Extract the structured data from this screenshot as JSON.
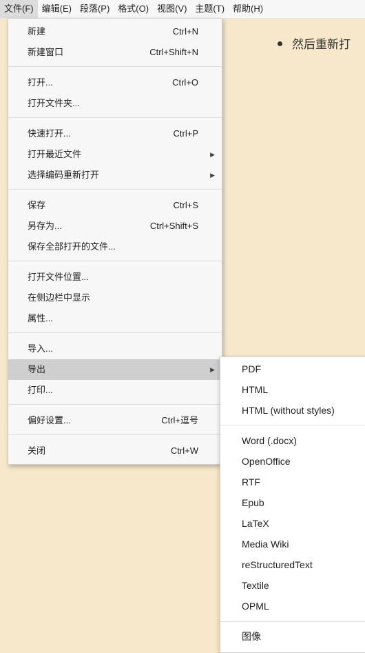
{
  "menubar": {
    "items": [
      "文件(F)",
      "编辑(E)",
      "段落(P)",
      "格式(O)",
      "视图(V)",
      "主题(T)",
      "帮助(H)"
    ]
  },
  "document": {
    "bullet_text": "然后重新打"
  },
  "file_menu": {
    "new": {
      "label": "新建",
      "shortcut": "Ctrl+N"
    },
    "new_window": {
      "label": "新建窗口",
      "shortcut": "Ctrl+Shift+N"
    },
    "open": {
      "label": "打开...",
      "shortcut": "Ctrl+O"
    },
    "open_folder": {
      "label": "打开文件夹..."
    },
    "quick_open": {
      "label": "快速打开...",
      "shortcut": "Ctrl+P"
    },
    "open_recent": {
      "label": "打开最近文件"
    },
    "reopen_encoding": {
      "label": "选择编码重新打开"
    },
    "save": {
      "label": "保存",
      "shortcut": "Ctrl+S"
    },
    "save_as": {
      "label": "另存为...",
      "shortcut": "Ctrl+Shift+S"
    },
    "save_all": {
      "label": "保存全部打开的文件..."
    },
    "open_location": {
      "label": "打开文件位置..."
    },
    "show_sidebar": {
      "label": "在侧边栏中显示"
    },
    "properties": {
      "label": "属性..."
    },
    "import": {
      "label": "导入..."
    },
    "export": {
      "label": "导出"
    },
    "print": {
      "label": "打印..."
    },
    "preferences": {
      "label": "偏好设置...",
      "shortcut": "Ctrl+逗号"
    },
    "close": {
      "label": "关闭",
      "shortcut": "Ctrl+W"
    }
  },
  "export_menu": {
    "items": [
      "PDF",
      "HTML",
      "HTML (without styles)",
      "Word (.docx)",
      "OpenOffice",
      "RTF",
      "Epub",
      "LaTeX",
      "Media Wiki",
      "reStructuredText",
      "Textile",
      "OPML",
      "图像"
    ]
  },
  "icons": {
    "submenu_arrow": "triangle-right-icon"
  },
  "colors": {
    "editor_background": "#f7e8cb",
    "menu_background": "#f7f7f7",
    "highlight": "#cfcfcf"
  }
}
